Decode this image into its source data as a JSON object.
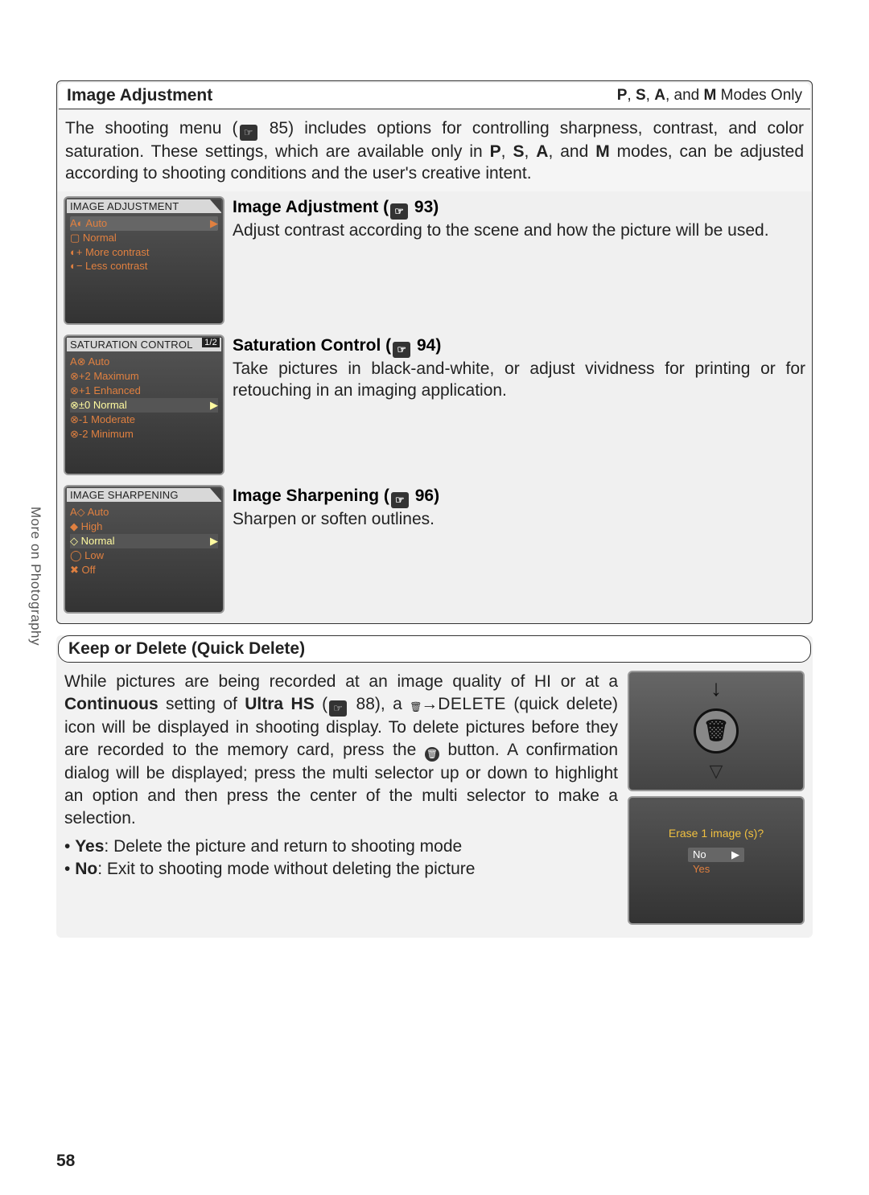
{
  "sidebar": {
    "label": "More on Photography"
  },
  "pageNumber": "58",
  "section1": {
    "headerLeft": "Image Adjustment",
    "headerRight_pre": "P",
    "headerRight_sep1": ", ",
    "headerRight_s": "S",
    "headerRight_sep2": ", ",
    "headerRight_a": "A",
    "headerRight_sep3": ", and ",
    "headerRight_m": "M",
    "headerRight_post": " Modes Only",
    "intro_a": "The shooting menu (",
    "intro_ref": "85",
    "intro_b": ") includes options for controlling sharpness, contrast, and color saturation.  These settings, which are available only in ",
    "intro_p": "P",
    "intro_s": "S",
    "intro_a2": "A",
    "intro_m": "M",
    "intro_c": " modes, can be adjusted according to shooting conditions and the user's creative intent.",
    "rows": [
      {
        "thumbTitle": "IMAGE ADJUSTMENT",
        "items": [
          "A◐ Auto",
          "▢ Normal",
          "◐+ More contrast",
          "◐− Less contrast"
        ],
        "selectedIndex": 0,
        "title_a": "Image Adjustment (",
        "ref": "93",
        "title_b": ")",
        "body": "Adjust contrast according to the scene and how the picture will be used."
      },
      {
        "thumbTitle": "SATURATION CONTROL",
        "badge": "1/2",
        "items": [
          "A⊗ Auto",
          "⊗+2 Maximum",
          "⊗+1 Enhanced",
          "⊗±0 Normal",
          "⊗-1 Moderate",
          "⊗-2 Minimum"
        ],
        "selectedIndex": 3,
        "title_a": "Saturation Control (",
        "ref": "94",
        "title_b": ")",
        "body": "Take pictures in black-and-white, or adjust vividness for printing or for retouching in an imaging application."
      },
      {
        "thumbTitle": "IMAGE SHARPENING",
        "items": [
          "A◇ Auto",
          "◆ High",
          "◇ Normal",
          "◯ Low",
          "✖ Off"
        ],
        "selectedIndex": 2,
        "title_a": "Image Sharpening (",
        "ref": "96",
        "title_b": ")",
        "body": "Sharpen or soften outlines."
      }
    ]
  },
  "section2": {
    "header": "Keep or Delete (Quick Delete)",
    "p1a": "While pictures are being recorded at an image quality of HI or at a ",
    "p1b": "Continuous",
    "p1c": " setting of ",
    "p1d": "Ultra HS",
    "p1e": " (",
    "p1ref": "88",
    "p1f": "), a ",
    "p1g": "→",
    "p1h": "DELETE",
    "p2": " (quick delete) icon will be displayed in shooting display.  To delete pictures before they are recorded to the memory card, press the ",
    "p3": " button.  A confirmation dialog will be displayed; press the multi selector up or down to highlight an option and then press the center of the multi selector to make a selection.",
    "bullets": [
      {
        "k": "Yes",
        "v": ": Delete the picture and return to shooting mode"
      },
      {
        "k": "No",
        "v": ": Exit to shooting mode without deleting the picture"
      }
    ],
    "eraseQ": "Erase 1 image (s)?",
    "optNo": "No",
    "optYes": "Yes"
  }
}
